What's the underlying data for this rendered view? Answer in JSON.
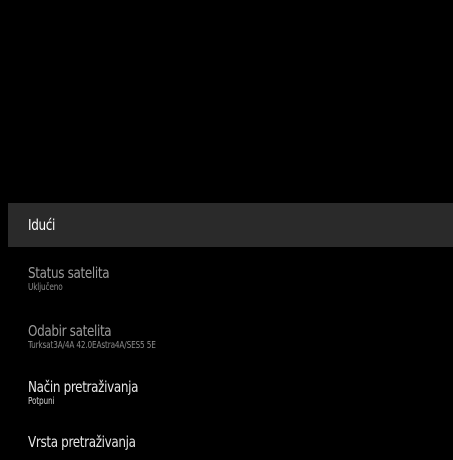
{
  "menu": {
    "items": [
      {
        "title": "Idući",
        "subtitle": ""
      },
      {
        "title": "Status satelita",
        "subtitle": "Uključeno"
      },
      {
        "title": "Odabir satelita",
        "subtitle": "Turksat3A/4A 42.0EAstra4A/SES5 5E"
      },
      {
        "title": "Način pretraživanja",
        "subtitle": "Potpuni"
      },
      {
        "title": "Vrsta pretraživanja",
        "subtitle": ""
      }
    ]
  },
  "colors": {
    "background": "#000000",
    "selected_row": "#2a2a2a",
    "text_bright": "#e6e6e6",
    "text_dim": "#9b9b9b"
  }
}
